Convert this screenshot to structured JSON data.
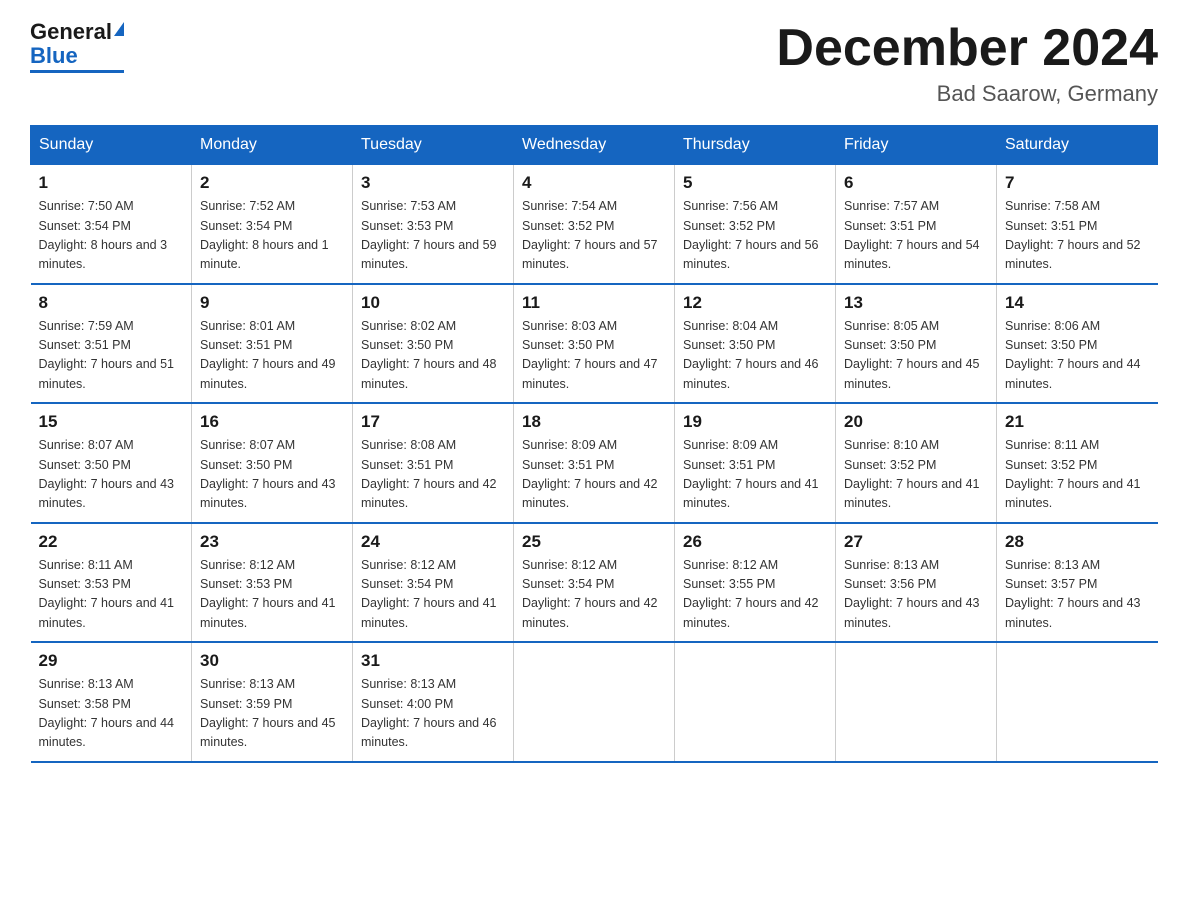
{
  "logo": {
    "general": "General",
    "triangle": "▲",
    "blue": "Blue"
  },
  "title": "December 2024",
  "location": "Bad Saarow, Germany",
  "days_of_week": [
    "Sunday",
    "Monday",
    "Tuesday",
    "Wednesday",
    "Thursday",
    "Friday",
    "Saturday"
  ],
  "weeks": [
    [
      {
        "day": "1",
        "sunrise": "7:50 AM",
        "sunset": "3:54 PM",
        "daylight": "8 hours and 3 minutes."
      },
      {
        "day": "2",
        "sunrise": "7:52 AM",
        "sunset": "3:54 PM",
        "daylight": "8 hours and 1 minute."
      },
      {
        "day": "3",
        "sunrise": "7:53 AM",
        "sunset": "3:53 PM",
        "daylight": "7 hours and 59 minutes."
      },
      {
        "day": "4",
        "sunrise": "7:54 AM",
        "sunset": "3:52 PM",
        "daylight": "7 hours and 57 minutes."
      },
      {
        "day": "5",
        "sunrise": "7:56 AM",
        "sunset": "3:52 PM",
        "daylight": "7 hours and 56 minutes."
      },
      {
        "day": "6",
        "sunrise": "7:57 AM",
        "sunset": "3:51 PM",
        "daylight": "7 hours and 54 minutes."
      },
      {
        "day": "7",
        "sunrise": "7:58 AM",
        "sunset": "3:51 PM",
        "daylight": "7 hours and 52 minutes."
      }
    ],
    [
      {
        "day": "8",
        "sunrise": "7:59 AM",
        "sunset": "3:51 PM",
        "daylight": "7 hours and 51 minutes."
      },
      {
        "day": "9",
        "sunrise": "8:01 AM",
        "sunset": "3:51 PM",
        "daylight": "7 hours and 49 minutes."
      },
      {
        "day": "10",
        "sunrise": "8:02 AM",
        "sunset": "3:50 PM",
        "daylight": "7 hours and 48 minutes."
      },
      {
        "day": "11",
        "sunrise": "8:03 AM",
        "sunset": "3:50 PM",
        "daylight": "7 hours and 47 minutes."
      },
      {
        "day": "12",
        "sunrise": "8:04 AM",
        "sunset": "3:50 PM",
        "daylight": "7 hours and 46 minutes."
      },
      {
        "day": "13",
        "sunrise": "8:05 AM",
        "sunset": "3:50 PM",
        "daylight": "7 hours and 45 minutes."
      },
      {
        "day": "14",
        "sunrise": "8:06 AM",
        "sunset": "3:50 PM",
        "daylight": "7 hours and 44 minutes."
      }
    ],
    [
      {
        "day": "15",
        "sunrise": "8:07 AM",
        "sunset": "3:50 PM",
        "daylight": "7 hours and 43 minutes."
      },
      {
        "day": "16",
        "sunrise": "8:07 AM",
        "sunset": "3:50 PM",
        "daylight": "7 hours and 43 minutes."
      },
      {
        "day": "17",
        "sunrise": "8:08 AM",
        "sunset": "3:51 PM",
        "daylight": "7 hours and 42 minutes."
      },
      {
        "day": "18",
        "sunrise": "8:09 AM",
        "sunset": "3:51 PM",
        "daylight": "7 hours and 42 minutes."
      },
      {
        "day": "19",
        "sunrise": "8:09 AM",
        "sunset": "3:51 PM",
        "daylight": "7 hours and 41 minutes."
      },
      {
        "day": "20",
        "sunrise": "8:10 AM",
        "sunset": "3:52 PM",
        "daylight": "7 hours and 41 minutes."
      },
      {
        "day": "21",
        "sunrise": "8:11 AM",
        "sunset": "3:52 PM",
        "daylight": "7 hours and 41 minutes."
      }
    ],
    [
      {
        "day": "22",
        "sunrise": "8:11 AM",
        "sunset": "3:53 PM",
        "daylight": "7 hours and 41 minutes."
      },
      {
        "day": "23",
        "sunrise": "8:12 AM",
        "sunset": "3:53 PM",
        "daylight": "7 hours and 41 minutes."
      },
      {
        "day": "24",
        "sunrise": "8:12 AM",
        "sunset": "3:54 PM",
        "daylight": "7 hours and 41 minutes."
      },
      {
        "day": "25",
        "sunrise": "8:12 AM",
        "sunset": "3:54 PM",
        "daylight": "7 hours and 42 minutes."
      },
      {
        "day": "26",
        "sunrise": "8:12 AM",
        "sunset": "3:55 PM",
        "daylight": "7 hours and 42 minutes."
      },
      {
        "day": "27",
        "sunrise": "8:13 AM",
        "sunset": "3:56 PM",
        "daylight": "7 hours and 43 minutes."
      },
      {
        "day": "28",
        "sunrise": "8:13 AM",
        "sunset": "3:57 PM",
        "daylight": "7 hours and 43 minutes."
      }
    ],
    [
      {
        "day": "29",
        "sunrise": "8:13 AM",
        "sunset": "3:58 PM",
        "daylight": "7 hours and 44 minutes."
      },
      {
        "day": "30",
        "sunrise": "8:13 AM",
        "sunset": "3:59 PM",
        "daylight": "7 hours and 45 minutes."
      },
      {
        "day": "31",
        "sunrise": "8:13 AM",
        "sunset": "4:00 PM",
        "daylight": "7 hours and 46 minutes."
      },
      null,
      null,
      null,
      null
    ]
  ]
}
